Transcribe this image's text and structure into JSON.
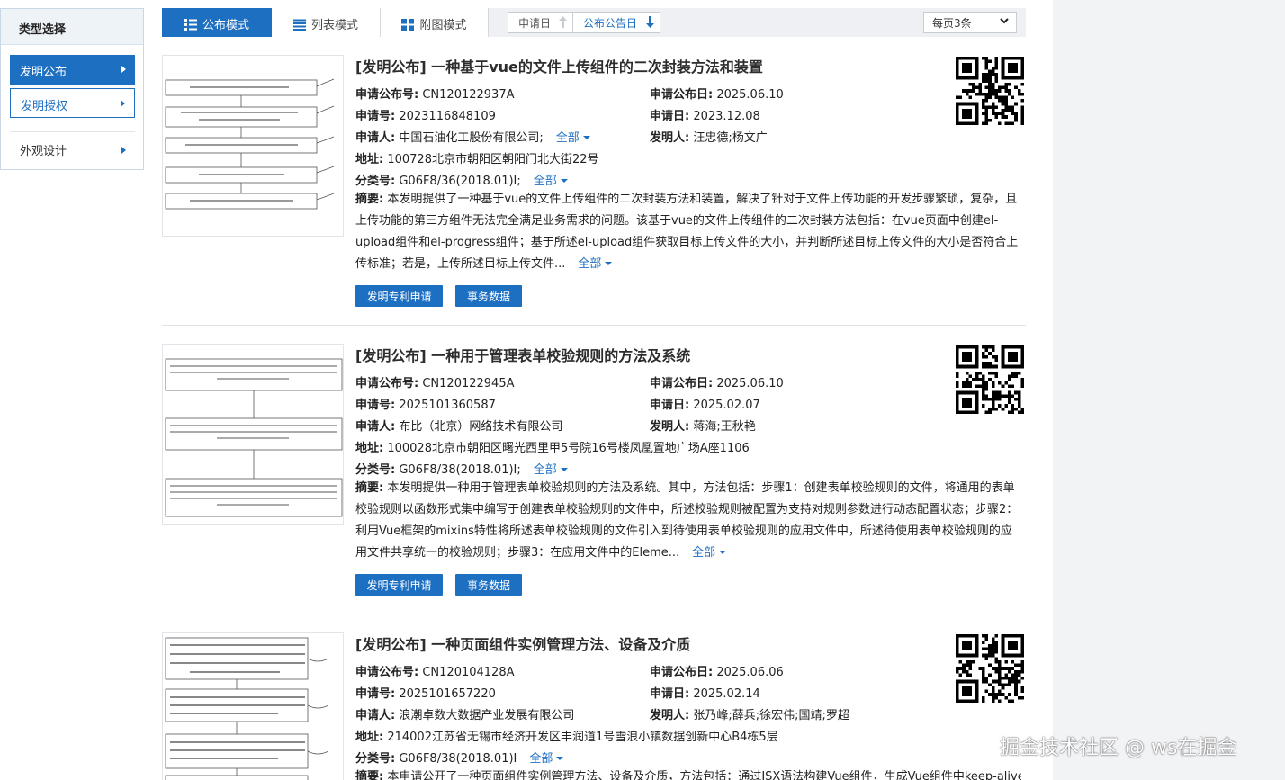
{
  "sidebar": {
    "header": "类型选择",
    "items": [
      {
        "label": "发明公布",
        "state": "active"
      },
      {
        "label": "发明授权",
        "state": "outlined"
      },
      {
        "label": "外观设计",
        "state": "plain"
      }
    ]
  },
  "toolbar": {
    "tabs": [
      {
        "label": "公布模式",
        "icon": "list-icon"
      },
      {
        "label": "列表模式",
        "icon": "lines-icon"
      },
      {
        "label": "附图模式",
        "icon": "grid-icon"
      }
    ],
    "sort": {
      "apply_date": "申请日",
      "pub_date": "公布公告日"
    },
    "per_page": "每页3条"
  },
  "results": [
    {
      "title": "[发明公布] 一种基于vue的文件上传组件的二次封装方法和装置",
      "pub_no_label": "申请公布号:",
      "pub_no": "CN120122937A",
      "pub_date_label": "申请公布日:",
      "pub_date": "2025.06.10",
      "app_no_label": "申请号:",
      "app_no": "2023116848109",
      "app_date_label": "申请日:",
      "app_date": "2023.12.08",
      "applicant_label": "申请人:",
      "applicant": "中国石油化工股份有限公司;",
      "inventor_label": "发明人:",
      "inventor": "汪忠德;杨文广",
      "address_label": "地址:",
      "address": "100728北京市朝阳区朝阳门北大街22号",
      "class_label": "分类号:",
      "class": "G06F8/36(2018.01)I;",
      "abstract_label": "摘要:",
      "abstract": "本发明提供了一种基于vue的文件上传组件的二次封装方法和装置，解决了针对于文件上传功能的开发步骤繁琐，复杂，且上传功能的第三方组件无法完全满足业务需求的问题。该基于vue的文件上传组件的二次封装方法包括：在vue页面中创建el-upload组件和el-progress组件；基于所述el-upload组件获取目标上传文件的大小，并判断所述目标上传文件的大小是否符合上传标准；若是，上传所述目标上传文件...",
      "more": "全部",
      "btn1": "发明专利申请",
      "btn2": "事务数据"
    },
    {
      "title": "[发明公布] 一种用于管理表单校验规则的方法及系统",
      "pub_no_label": "申请公布号:",
      "pub_no": "CN120122945A",
      "pub_date_label": "申请公布日:",
      "pub_date": "2025.06.10",
      "app_no_label": "申请号:",
      "app_no": "2025101360587",
      "app_date_label": "申请日:",
      "app_date": "2025.02.07",
      "applicant_label": "申请人:",
      "applicant": "布比（北京）网络技术有限公司",
      "inventor_label": "发明人:",
      "inventor": "蒋海;王秋艳",
      "address_label": "地址:",
      "address": "100028北京市朝阳区曙光西里甲5号院16号楼凤凰置地广场A座1106",
      "class_label": "分类号:",
      "class": "G06F8/38(2018.01)I;",
      "abstract_label": "摘要:",
      "abstract": "本发明提供一种用于管理表单校验规则的方法及系统。其中，方法包括：步骤1：创建表单校验规则的文件，将通用的表单校验规则以函数形式集中编写于创建表单校验规则的文件中，所述校验规则被配置为支持对规则参数进行动态配置状态；步骤2：利用Vue框架的mixins特性将所述表单校验规则的文件引入到待使用表单校验规则的应用文件中，所述待使用表单校验规则的应用文件共享统一的校验规则；步骤3：在应用文件中的Eleme...",
      "more": "全部",
      "btn1": "发明专利申请",
      "btn2": "事务数据"
    },
    {
      "title": "[发明公布] 一种页面组件实例管理方法、设备及介质",
      "pub_no_label": "申请公布号:",
      "pub_no": "CN120104128A",
      "pub_date_label": "申请公布日:",
      "pub_date": "2025.06.06",
      "app_no_label": "申请号:",
      "app_no": "2025101657220",
      "app_date_label": "申请日:",
      "app_date": "2025.02.14",
      "applicant_label": "申请人:",
      "applicant": "浪潮卓数大数据产业发展有限公司",
      "inventor_label": "发明人:",
      "inventor": "张乃峰;薛兵;徐宏伟;国靖;罗超",
      "address_label": "地址:",
      "address": "214002江苏省无锡市经济开发区丰润道1号雪浪小镇数据创新中心B4栋5层",
      "class_label": "分类号:",
      "class": "G06F8/38(2018.01)I",
      "abstract_label": "摘要:",
      "abstract": "本申请公开了一种页面组件实例管理方法、设备及介质，方法包括：通过JSX语法构建Vue组件，生成Vue组件中keep-alive",
      "more": "全部"
    }
  ],
  "watermark": "掘金技术社区 @ ws在掘金"
}
